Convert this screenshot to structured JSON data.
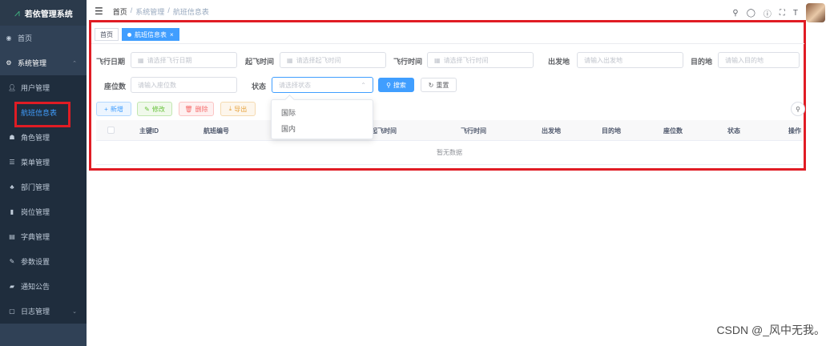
{
  "app": {
    "title": "若依管理系统"
  },
  "sidebar": {
    "home": "首页",
    "system": "系统管理",
    "items": [
      {
        "label": "用户管理",
        "icon": "user-icon"
      },
      {
        "label": "航班信息表",
        "icon": "none",
        "active": true
      },
      {
        "label": "角色管理",
        "icon": "peoples-icon"
      },
      {
        "label": "菜单管理",
        "icon": "tree-table-icon"
      },
      {
        "label": "部门管理",
        "icon": "tree-icon"
      },
      {
        "label": "岗位管理",
        "icon": "post-icon"
      },
      {
        "label": "字典管理",
        "icon": "dict-icon"
      },
      {
        "label": "参数设置",
        "icon": "edit-icon"
      },
      {
        "label": "通知公告",
        "icon": "message-icon"
      },
      {
        "label": "日志管理",
        "icon": "log-icon"
      }
    ]
  },
  "breadcrumb": [
    "首页",
    "/",
    "系统管理",
    "/",
    "航班信息表"
  ],
  "tags": {
    "home": "首页",
    "current": "航班信息表",
    "close": "×"
  },
  "form": {
    "flight_date": {
      "label": "飞行日期",
      "placeholder": "请选择飞行日期"
    },
    "takeoff_time": {
      "label": "起飞时间",
      "placeholder": "请选择起飞时间"
    },
    "flight_time": {
      "label": "飞行时间",
      "placeholder": "请选择飞行时间"
    },
    "departure": {
      "label": "出发地",
      "placeholder": "请输入出发地"
    },
    "destination": {
      "label": "目的地",
      "placeholder": "请输入目的地"
    },
    "seats": {
      "label": "座位数",
      "placeholder": "请输入座位数"
    },
    "status": {
      "label": "状态",
      "placeholder": "请选择状态"
    },
    "search_btn": "搜索",
    "reset_btn": "重置"
  },
  "toolbar": {
    "add": "新增",
    "edit": "修改",
    "delete": "删除",
    "export": "导出"
  },
  "table": {
    "columns": [
      "主键ID",
      "航班编号",
      "起飞时间",
      "飞行时间",
      "出发地",
      "目的地",
      "座位数",
      "状态",
      "操作"
    ],
    "empty_text": "暂无数据"
  },
  "dropdown": {
    "options": [
      "国际",
      "国内"
    ]
  },
  "watermark": "CSDN @_风中无我。",
  "colors": {
    "accent": "#409eff",
    "sidebar_bg": "#304156",
    "highlight_box": "#e01c24"
  }
}
